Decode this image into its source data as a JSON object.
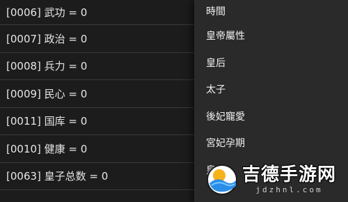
{
  "variables": [
    {
      "label": "[0006] 武功 = 0"
    },
    {
      "label": "[0007] 政治 = 0"
    },
    {
      "label": "[0008] 兵力 = 0"
    },
    {
      "label": "[0009] 民心 = 0"
    },
    {
      "label": "[0011] 国库 = 0"
    },
    {
      "label": "[0010] 健康 = 0"
    },
    {
      "label": "[0063] 皇子总数 = 0"
    }
  ],
  "menu": {
    "items": [
      {
        "label": "時間"
      },
      {
        "label": "皇帝屬性"
      },
      {
        "label": "皇后"
      },
      {
        "label": "太子"
      },
      {
        "label": "後妃寵愛"
      },
      {
        "label": "宮妃孕期"
      },
      {
        "label": "皇子"
      }
    ]
  },
  "watermark": {
    "title": "吉德手游网",
    "subtitle": "jdzhnl.com",
    "colors": {
      "sun": "#f5b21b",
      "wave": "#2a8ee8",
      "wave_light": "#7cc8ff"
    }
  }
}
